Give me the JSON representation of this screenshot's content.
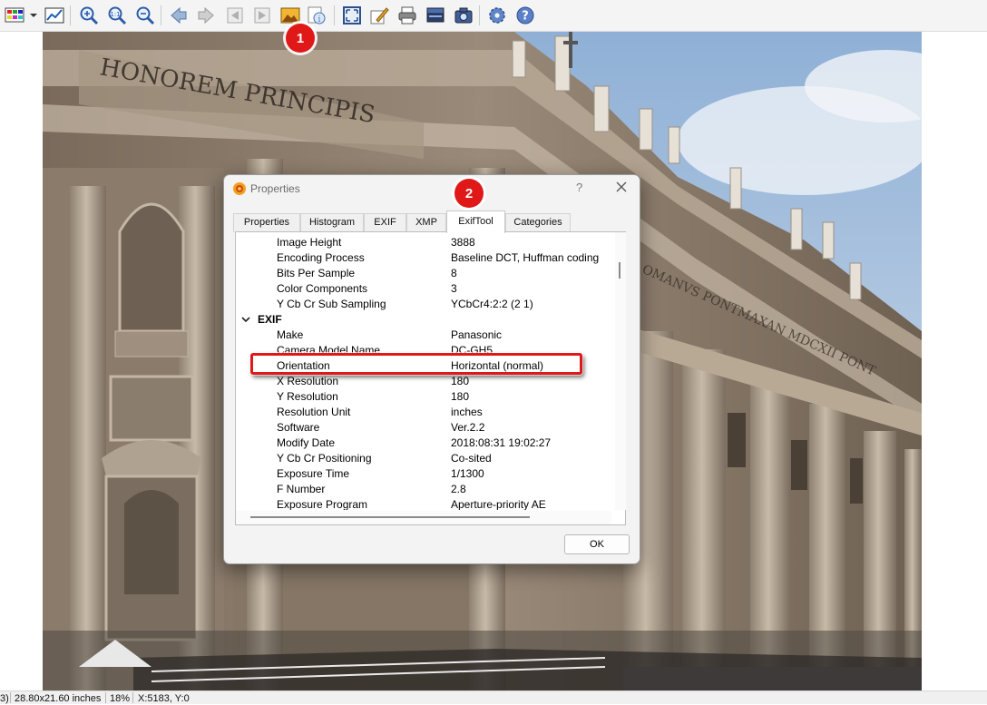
{
  "toolbar": {
    "icons": [
      "palette-icon",
      "dropdown-arrow-icon",
      "chart-icon",
      "zoom-in-icon",
      "zoom-actual-icon",
      "zoom-out-icon",
      "back-arrow-icon",
      "forward-arrow-icon",
      "previous-page-icon",
      "next-page-icon",
      "image-properties-icon",
      "image-info-icon",
      "fit-screen-icon",
      "edit-paint-icon",
      "print-icon",
      "scanner-icon",
      "camera-icon",
      "settings-icon",
      "help-icon"
    ]
  },
  "badges": {
    "one": "1",
    "two": "2"
  },
  "dialog": {
    "title": "Properties",
    "help": "?",
    "tabs": [
      "Properties",
      "Histogram",
      "EXIF",
      "XMP",
      "ExifTool",
      "Categories"
    ],
    "active_tab": "ExifTool",
    "rows": [
      {
        "key": "Image Height",
        "value": "3888"
      },
      {
        "key": "Encoding Process",
        "value": "Baseline DCT, Huffman coding"
      },
      {
        "key": "Bits Per Sample",
        "value": "8"
      },
      {
        "key": "Color Components",
        "value": "3"
      },
      {
        "key": "Y Cb Cr Sub Sampling",
        "value": "YCbCr4:2:2 (2 1)"
      },
      {
        "key": "EXIF",
        "value": "",
        "group": true
      },
      {
        "key": "Make",
        "value": "Panasonic"
      },
      {
        "key": "Camera Model Name",
        "value": "DC-GH5"
      },
      {
        "key": "Orientation",
        "value": "Horizontal (normal)"
      },
      {
        "key": "X Resolution",
        "value": "180"
      },
      {
        "key": "Y Resolution",
        "value": "180"
      },
      {
        "key": "Resolution Unit",
        "value": "inches"
      },
      {
        "key": "Software",
        "value": "Ver.2.2"
      },
      {
        "key": "Modify Date",
        "value": "2018:08:31 19:02:27"
      },
      {
        "key": "Y Cb Cr Positioning",
        "value": "Co-sited"
      },
      {
        "key": "Exposure Time",
        "value": "1/1300"
      },
      {
        "key": "F Number",
        "value": "2.8"
      },
      {
        "key": "Exposure Program",
        "value": "Aperture-priority AE"
      }
    ],
    "ok_label": "OK"
  },
  "status": {
    "left": "3)",
    "size": "28.80x21.60 inches",
    "zoom": "18%",
    "coords": "X:5183, Y:0"
  },
  "colors": {
    "badge": "#e01818",
    "highlight": "#e01818",
    "sky": "#a9c3dc",
    "stone": "#8a7b6c"
  }
}
